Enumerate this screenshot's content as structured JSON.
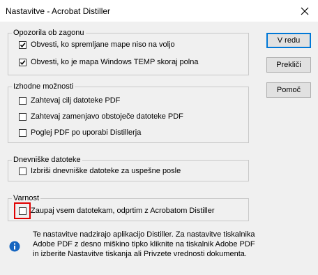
{
  "window": {
    "title": "Nastavitve - Acrobat Distiller"
  },
  "groups": {
    "warnings": {
      "legend": "Opozorila ob zagonu",
      "items": [
        {
          "label": "Obvesti, ko spremljane mape niso na voljo",
          "checked": true
        },
        {
          "label": "Obvesti, ko je mapa Windows TEMP skoraj polna",
          "checked": true
        }
      ]
    },
    "output": {
      "legend": "Izhodne možnosti",
      "items": [
        {
          "label": "Zahtevaj cilj datoteke PDF",
          "checked": false
        },
        {
          "label": "Zahtevaj zamenjavo obstoječe datoteke PDF",
          "checked": false
        },
        {
          "label": "Poglej PDF po uporabi Distillerja",
          "checked": false
        }
      ]
    },
    "logs": {
      "legend": "Dnevniške datoteke",
      "items": [
        {
          "label": "Izbriši dnevniške datoteke za uspešne posle",
          "checked": false
        }
      ]
    },
    "security": {
      "legend": "Varnost",
      "items": [
        {
          "label": "Zaupaj vsem datotekam, odprtim z Acrobatom Distiller",
          "checked": false
        }
      ]
    }
  },
  "buttons": {
    "ok": "V redu",
    "cancel": "Prekliči",
    "help": "Pomoč"
  },
  "info": {
    "text": "Te nastavitve nadzirajo aplikacijo Distiller. Za nastavitve tiskalnika Adobe PDF z desno miškino tipko kliknite na tiskalnik Adobe PDF in izberite Nastavitve tiskanja ali Privzete vrednosti dokumenta."
  },
  "colors": {
    "highlight": "#e00000",
    "info_icon": "#1565c0"
  }
}
